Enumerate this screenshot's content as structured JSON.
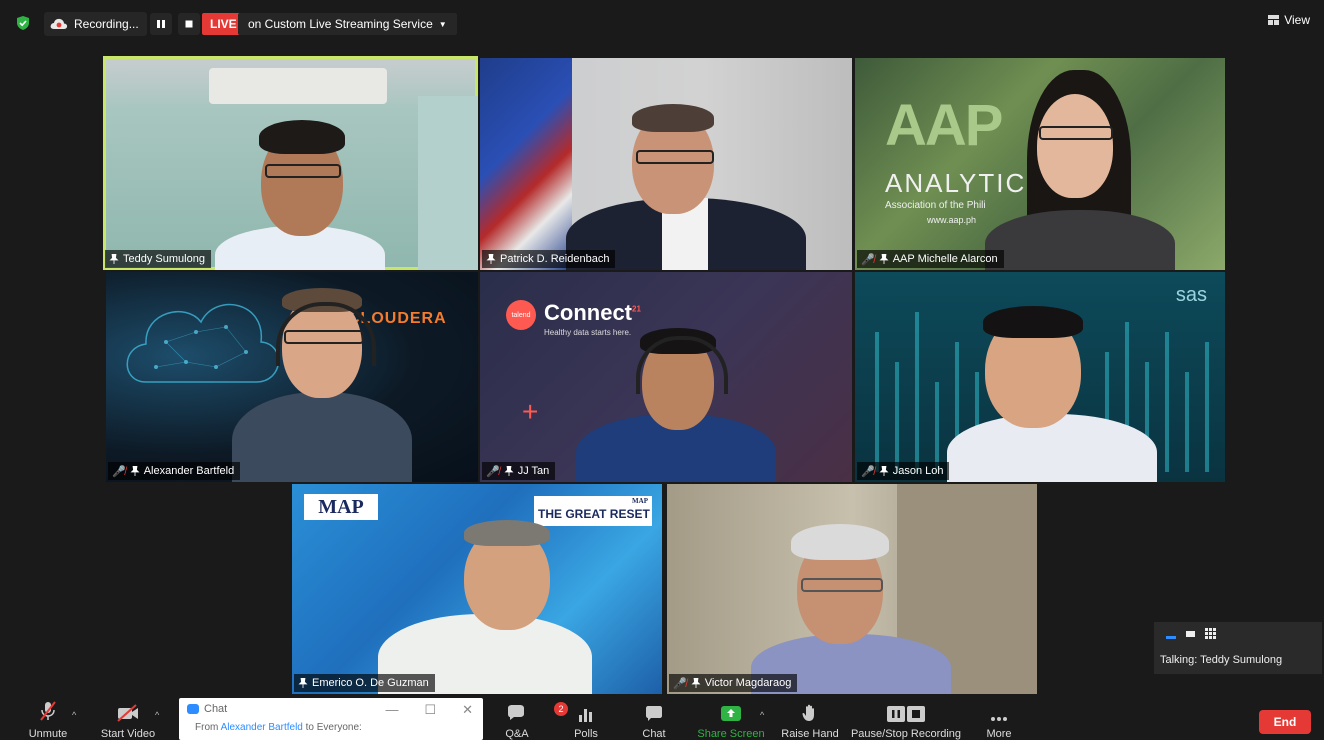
{
  "topbar": {
    "recording_label": "Recording...",
    "live_label": "LIVE",
    "stream_label": "on Custom Live Streaming Service",
    "view_label": "View"
  },
  "tiles": [
    {
      "name": "Teddy Sumulong",
      "active": true,
      "muted": false
    },
    {
      "name": "Patrick D. Reidenbach",
      "active": false,
      "muted": false
    },
    {
      "name": "AAP Michelle Alarcon",
      "active": false,
      "muted": true
    },
    {
      "name": "Alexander Bartfeld",
      "active": false,
      "muted": true
    },
    {
      "name": "JJ Tan",
      "active": false,
      "muted": true
    },
    {
      "name": "Jason Loh",
      "active": false,
      "muted": true
    },
    {
      "name": "Emerico O. De Guzman",
      "active": false,
      "muted": false
    },
    {
      "name": "Victor Magdaraog",
      "active": false,
      "muted": true
    }
  ],
  "backgrounds": {
    "aap_title": "AAP",
    "aap_sub": "ANALYTICS",
    "aap_line": "Association of the Phili",
    "aap_url": "www.aap.ph",
    "cloudera": "CLOUDERA",
    "talend_badge": "talend",
    "connect": "Connect",
    "connect_sup": "21",
    "connect_tag": "Healthy data starts here.",
    "sas": "sas",
    "map_logo": "MAP",
    "map_small": "MAP",
    "great_reset": "THE GREAT RESET"
  },
  "toolbar": {
    "unmute": "Unmute",
    "start_video": "Start Video",
    "qa": "Q&A",
    "qa_badge": "2",
    "polls": "Polls",
    "chat": "Chat",
    "share_screen": "Share Screen",
    "raise_hand": "Raise Hand",
    "pause_recording": "Pause/Stop Recording",
    "more": "More",
    "end": "End"
  },
  "chat_popup": {
    "title": "Chat",
    "from_prefix": "From",
    "sender": "Alexander Bartfeld",
    "to_text": "to Everyone:"
  },
  "talking": {
    "text": "Talking: Teddy Sumulong"
  },
  "colors": {
    "active_speaker": "#c8e66a",
    "live_red": "#e53935",
    "share_green": "#2fb344",
    "zoom_blue": "#2d8cff"
  }
}
